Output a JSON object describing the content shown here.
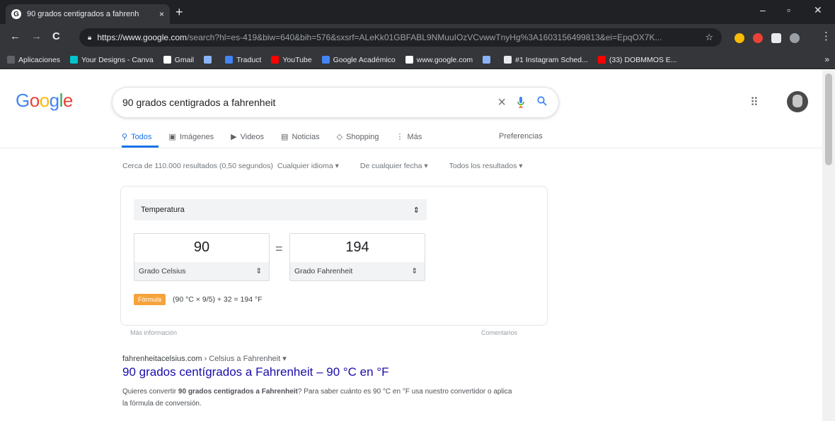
{
  "browser": {
    "tab_title": "90 grados centigrados a fahrenh",
    "tab_close": "×",
    "new_tab": "+",
    "minimize": "–",
    "maximize": "▫",
    "close": "✕",
    "back": "←",
    "forward": "→",
    "reload": "C",
    "url_host": "https://www.google.com",
    "url_path": "/search?hl=es-419&biw=640&bih=576&sxsrf=ALeKk01GBFABL9NMuuIOzVCvwwTnyHg%3A1603156499813&ei=EpqOX7K...",
    "bookmarks": [
      {
        "label": "Aplicaciones",
        "color": "#5f6368"
      },
      {
        "label": "Your Designs - Canva",
        "color": "#00c4cc"
      },
      {
        "label": "Gmail",
        "color": "#ffffff"
      },
      {
        "label": "",
        "color": "#8ab4f8"
      },
      {
        "label": "Traduct",
        "color": "#4285f4"
      },
      {
        "label": "YouTube",
        "color": "#ff0000"
      },
      {
        "label": "Google Académico",
        "color": "#4285f4"
      },
      {
        "label": "www.google.com",
        "color": "#ffffff"
      },
      {
        "label": "",
        "color": "#8ab4f8"
      },
      {
        "label": "#1 Instagram Sched...",
        "color": "#e8eaed"
      },
      {
        "label": "(33) DOBMMOS E...",
        "color": "#ff0000"
      }
    ],
    "bookmarks_more": "»"
  },
  "google": {
    "logo": [
      "G",
      "o",
      "o",
      "g",
      "l",
      "e"
    ],
    "logo_colors": [
      "#4285f4",
      "#ea4335",
      "#fbbc05",
      "#4285f4",
      "#34a853",
      "#ea4335"
    ],
    "query": "90 grados centigrados a fahrenheit",
    "clear": "×",
    "search_icon": "⚲",
    "apps_icon": "⠿",
    "tabs": [
      {
        "icon": "⚲",
        "label": "Todos",
        "active": true
      },
      {
        "icon": "▣",
        "label": "Imágenes"
      },
      {
        "icon": "▶",
        "label": "Videos"
      },
      {
        "icon": "▤",
        "label": "Noticias"
      },
      {
        "icon": "◇",
        "label": "Shopping"
      },
      {
        "icon": "⋮",
        "label": "Más"
      }
    ],
    "preferences": "Preferencias",
    "stats": "Cerca de 110.000 resultados (0,50 segundos)",
    "filter_language": "Cualquier idioma ▾",
    "filter_date": "De cualquier fecha ▾",
    "filter_results": "Todos los resultados ▾"
  },
  "converter": {
    "category": "Temperatura",
    "from_value": "90",
    "from_unit": "Grado Celsius",
    "equals": "=",
    "to_value": "194",
    "to_unit": "Grado Fahrenheit",
    "select_arrow": "⇕",
    "formula_label": "Fórmula",
    "formula": "(90 °C × 9/5) + 32 = 194 °F",
    "more_info": "Más información",
    "feedback": "Comentarios"
  },
  "result": {
    "site": "fahrenheitacelsius.com",
    "crumb": " › Celsius a Fahrenheit ▾",
    "title": "90 grados centígrados a Fahrenheit – 90 °C en °F",
    "snippet_pre": "Quieres convertir ",
    "snippet_bold": "90 grados centigrados a Fahrenheit",
    "snippet_post": "? Para saber cuánto es 90 °C en °F usa nuestro convertidor o aplica la fórmula de conversión."
  }
}
